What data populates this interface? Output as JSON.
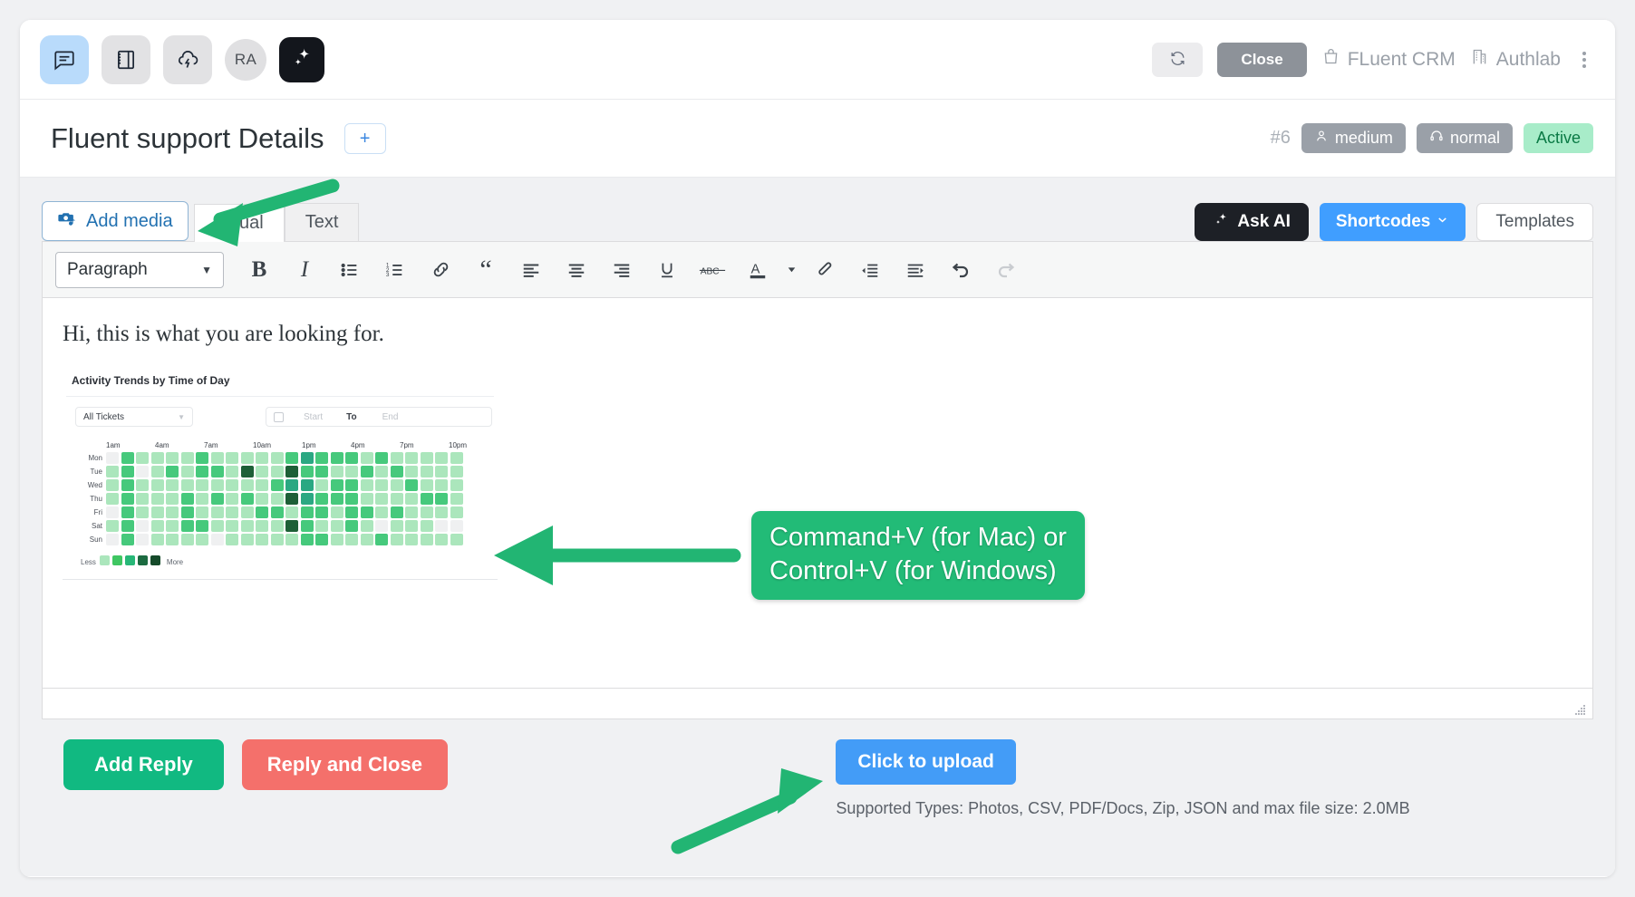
{
  "header": {
    "icons": [
      {
        "name": "conversation-icon",
        "label": "Conversation"
      },
      {
        "name": "notes-icon",
        "label": "Notes"
      },
      {
        "name": "cloud-bolt-icon",
        "label": "Activity"
      }
    ],
    "avatar_initials": "RA",
    "ai_tile_label": "AI",
    "refresh_label": "Refresh",
    "close_label": "Close",
    "links": [
      {
        "label": "FLuent CRM",
        "icon": "bag-icon"
      },
      {
        "label": "Authlab",
        "icon": "building-icon"
      }
    ],
    "kebab_label": "More options"
  },
  "title_bar": {
    "title": "Fluent support Details",
    "add_label": "+",
    "ticket_number": "#6",
    "badges": [
      {
        "label": "medium",
        "icon": "person-icon",
        "type": "priority"
      },
      {
        "label": "normal",
        "icon": "headset-icon",
        "type": "type"
      },
      {
        "label": "Active",
        "icon": "",
        "type": "status"
      }
    ]
  },
  "editor": {
    "add_media_label": "Add media",
    "tabs": [
      {
        "label": "Visual",
        "selected": true
      },
      {
        "label": "Text",
        "selected": false
      }
    ],
    "ask_ai_label": "Ask AI",
    "shortcodes_label": "Shortcodes",
    "templates_label": "Templates",
    "format_select_value": "Paragraph",
    "toolbar_buttons": [
      {
        "name": "bold-button",
        "label": "B"
      },
      {
        "name": "italic-button",
        "label": "I"
      },
      {
        "name": "bulleted-list-button",
        "label": "Bulleted list"
      },
      {
        "name": "numbered-list-button",
        "label": "Numbered list"
      },
      {
        "name": "insert-link-button",
        "label": "Link"
      },
      {
        "name": "blockquote-button",
        "label": "Blockquote"
      },
      {
        "name": "align-left-button",
        "label": "Align left"
      },
      {
        "name": "align-center-button",
        "label": "Align center"
      },
      {
        "name": "align-right-button",
        "label": "Align right"
      },
      {
        "name": "underline-button",
        "label": "U"
      },
      {
        "name": "strikethrough-button",
        "label": "ABC"
      },
      {
        "name": "text-color-button",
        "label": "A"
      },
      {
        "name": "clear-formatting-button",
        "label": "Clear formatting"
      },
      {
        "name": "outdent-button",
        "label": "Outdent"
      },
      {
        "name": "indent-button",
        "label": "Indent"
      },
      {
        "name": "undo-button",
        "label": "Undo"
      },
      {
        "name": "redo-button",
        "label": "Redo"
      }
    ],
    "content_text": "Hi, this is what you are looking for."
  },
  "chart_data": {
    "type": "heatmap",
    "title": "Activity Trends by Time of Day",
    "filter_value": "All Tickets",
    "date_range": {
      "start_placeholder": "Start",
      "to_label": "To",
      "end_placeholder": "End"
    },
    "xlabel": "",
    "ylabel": "",
    "x_tick_labels": [
      "1am",
      "4am",
      "7am",
      "10am",
      "1pm",
      "4pm",
      "7pm",
      "10pm"
    ],
    "categories": [
      "Mon",
      "Tue",
      "Wed",
      "Thu",
      "Fri",
      "Sat",
      "Sun"
    ],
    "legend": {
      "low_label": "Less",
      "high_label": "More",
      "position": "bottom-left",
      "colors": [
        "#abe6bc",
        "#3fc662",
        "#27b777",
        "#1c6b41",
        "#154a2a"
      ]
    },
    "grid": false,
    "values": [
      [
        0,
        3,
        1,
        1,
        1,
        1,
        3,
        1,
        1,
        1,
        1,
        1,
        3,
        4,
        3,
        3,
        3,
        1,
        3,
        1,
        1,
        1,
        1,
        1
      ],
      [
        1,
        3,
        0,
        1,
        3,
        1,
        3,
        3,
        1,
        5,
        1,
        1,
        5,
        3,
        3,
        1,
        1,
        3,
        1,
        3,
        1,
        1,
        1,
        1
      ],
      [
        1,
        3,
        1,
        1,
        1,
        1,
        1,
        1,
        1,
        1,
        1,
        3,
        4,
        4,
        1,
        3,
        3,
        1,
        1,
        1,
        3,
        1,
        1,
        1
      ],
      [
        1,
        3,
        1,
        1,
        1,
        3,
        1,
        3,
        1,
        3,
        1,
        1,
        5,
        4,
        3,
        3,
        3,
        1,
        1,
        1,
        1,
        3,
        3,
        1
      ],
      [
        0,
        3,
        1,
        1,
        1,
        3,
        1,
        1,
        1,
        1,
        3,
        3,
        1,
        3,
        3,
        1,
        3,
        3,
        1,
        3,
        1,
        1,
        1,
        1
      ],
      [
        1,
        3,
        0,
        1,
        1,
        3,
        3,
        1,
        1,
        1,
        1,
        1,
        5,
        3,
        1,
        1,
        3,
        1,
        0,
        1,
        1,
        1,
        0,
        0
      ],
      [
        0,
        3,
        0,
        1,
        1,
        1,
        1,
        0,
        1,
        1,
        1,
        1,
        1,
        3,
        3,
        1,
        1,
        1,
        3,
        1,
        1,
        1,
        1,
        1
      ]
    ],
    "value_scale": {
      "0": "#eff0f1",
      "1": "#abe6bc",
      "3": "#46c97c",
      "4": "#2aa882",
      "5": "#1d5f37"
    }
  },
  "footer": {
    "add_reply_label": "Add Reply",
    "reply_and_close_label": "Reply and Close",
    "upload_label": "Click to upload",
    "supported_note": "Supported Types: Photos, CSV, PDF/Docs, Zip, JSON and max file size: 2.0MB"
  },
  "annotations": {
    "paste_hint_line1": "Command+V (for Mac) or",
    "paste_hint_line2": "Control+V (for Windows)",
    "arrow_color": "#22b573"
  }
}
